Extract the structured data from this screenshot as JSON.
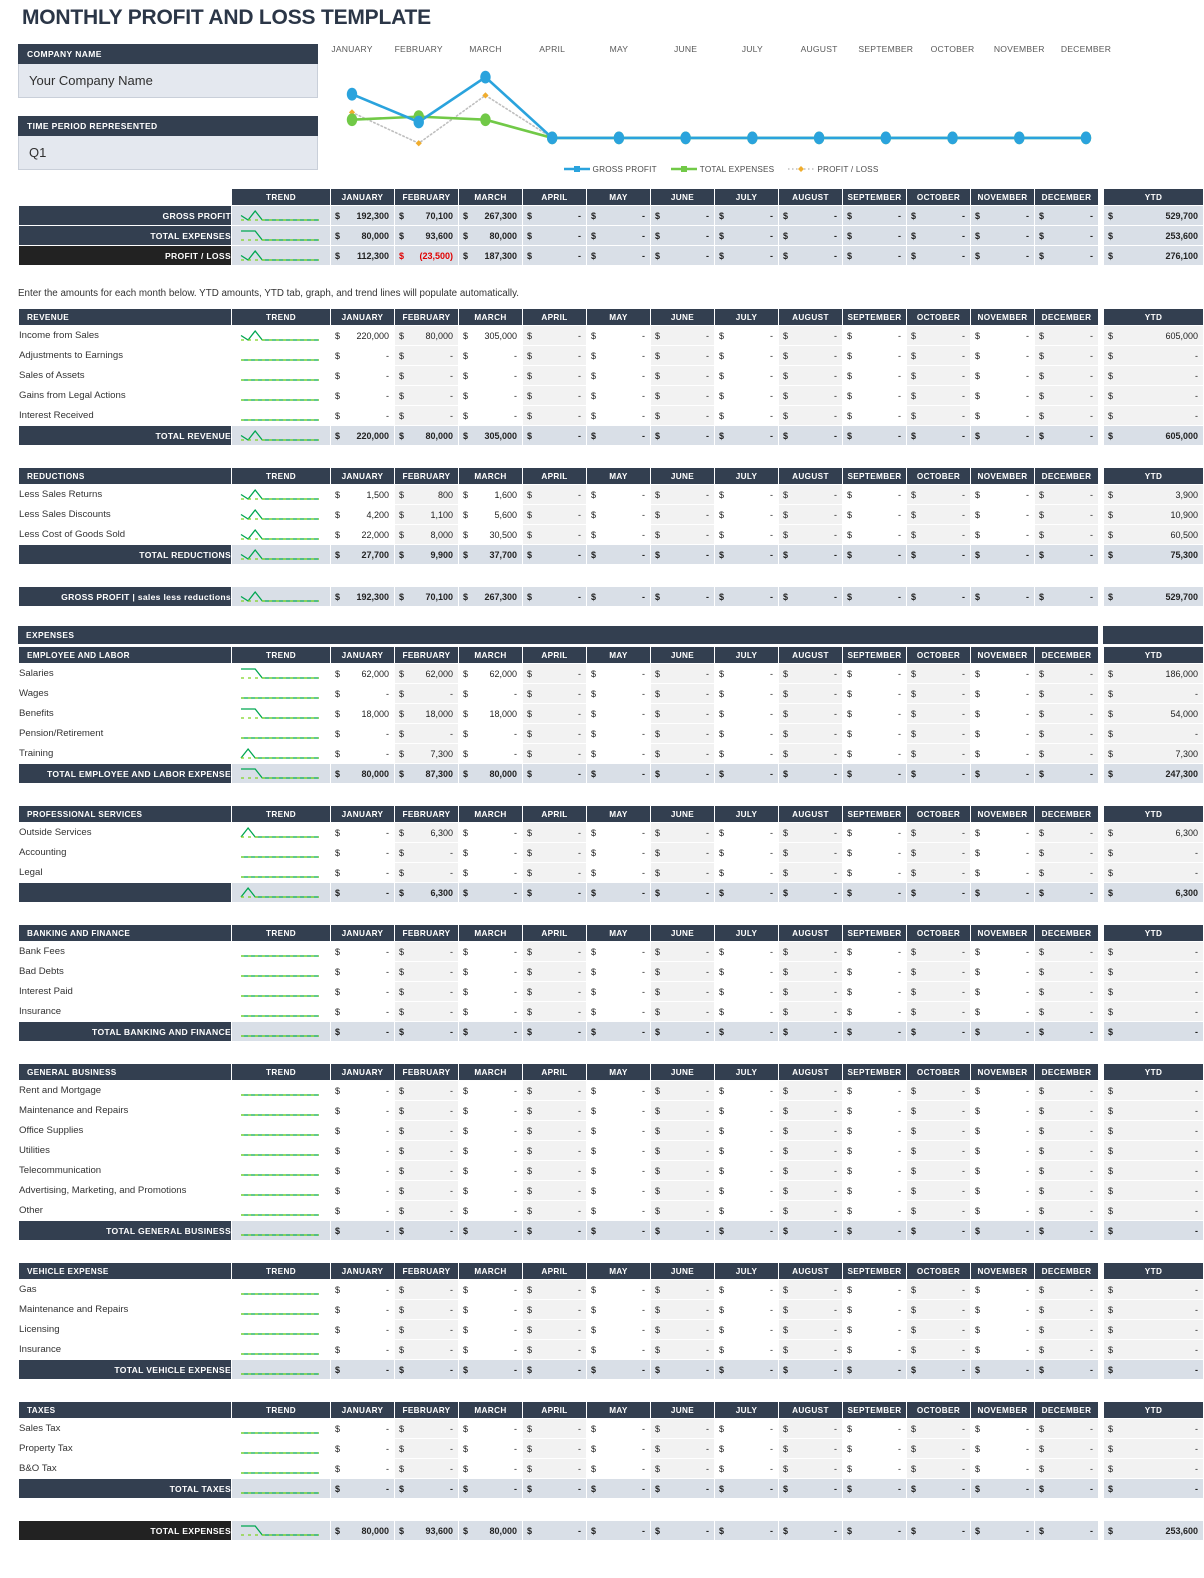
{
  "page_title": "MONTHLY PROFIT AND LOSS TEMPLATE",
  "info": {
    "company_label": "COMPANY NAME",
    "company_value": "Your Company Name",
    "period_label": "TIME PERIOD REPRESENTED",
    "period_value": "Q1"
  },
  "note": "Enter the amounts for each month below. YTD amounts, YTD tab, graph, and trend lines will populate automatically.",
  "months": [
    "JANUARY",
    "FEBRUARY",
    "MARCH",
    "APRIL",
    "MAY",
    "JUNE",
    "JULY",
    "AUGUST",
    "SEPTEMBER",
    "OCTOBER",
    "NOVEMBER",
    "DECEMBER"
  ],
  "col_trend": "TREND",
  "col_ytd": "YTD",
  "currency": "$",
  "dash": "-",
  "colors": {
    "header_dark": "#333f50",
    "header_black": "#222222",
    "total_fill": "#d9dfe7",
    "alt_fill": "#f2f2f2",
    "negative": "#e00000",
    "gross_profit_line": "#2aa3dd",
    "total_expenses_line": "#71c947",
    "profit_loss_line": "#bfbfbf",
    "profit_loss_marker": "#f0ad2e",
    "spark_line": "#00a651"
  },
  "chart_data": {
    "type": "line",
    "title": "",
    "xlabel": "",
    "ylabel": "",
    "categories": [
      "JANUARY",
      "FEBRUARY",
      "MARCH",
      "APRIL",
      "MAY",
      "JUNE",
      "JULY",
      "AUGUST",
      "SEPTEMBER",
      "OCTOBER",
      "NOVEMBER",
      "DECEMBER"
    ],
    "legend": [
      "GROSS PROFIT",
      "TOTAL EXPENSES",
      "PROFIT / LOSS"
    ],
    "legend_position": "bottom-center",
    "grid": false,
    "series": [
      {
        "name": "GROSS PROFIT",
        "color": "#2aa3dd",
        "values": [
          192300,
          70100,
          267300,
          0,
          0,
          0,
          0,
          0,
          0,
          0,
          0,
          0
        ]
      },
      {
        "name": "TOTAL EXPENSES",
        "color": "#71c947",
        "values": [
          80000,
          93600,
          80000,
          0,
          0,
          0,
          0,
          0,
          0,
          0,
          0,
          0
        ]
      },
      {
        "name": "PROFIT / LOSS",
        "color": "#bfbfbf",
        "values": [
          112300,
          -23500,
          187300,
          0,
          0,
          0,
          0,
          0,
          0,
          0,
          0,
          0
        ]
      }
    ],
    "ylim": [
      -40000,
      290000
    ]
  },
  "summary": {
    "header": [
      "",
      "TREND",
      "JANUARY",
      "FEBRUARY",
      "MARCH",
      "APRIL",
      "MAY",
      "JUNE",
      "JULY",
      "AUGUST",
      "SEPTEMBER",
      "OCTOBER",
      "NOVEMBER",
      "DECEMBER"
    ],
    "rows": [
      {
        "label": "GROSS PROFIT",
        "spark": "vpeak",
        "values": [
          "192,300",
          "70,100",
          "267,300",
          "-",
          "-",
          "-",
          "-",
          "-",
          "-",
          "-",
          "-",
          "-"
        ],
        "ytd": "529,700",
        "negatives": []
      },
      {
        "label": "TOTAL EXPENSES",
        "spark": "drop",
        "values": [
          "80,000",
          "93,600",
          "80,000",
          "-",
          "-",
          "-",
          "-",
          "-",
          "-",
          "-",
          "-",
          "-"
        ],
        "ytd": "253,600",
        "negatives": []
      },
      {
        "label": "PROFIT / LOSS",
        "spark": "vpeak",
        "values": [
          "112,300",
          "(23,500)",
          "187,300",
          "-",
          "-",
          "-",
          "-",
          "-",
          "-",
          "-",
          "-",
          "-"
        ],
        "ytd": "276,100",
        "negatives": [
          1
        ],
        "black": true
      }
    ]
  },
  "sections": [
    {
      "id": "revenue",
      "title": "REVENUE",
      "rows": [
        {
          "label": "Income from Sales",
          "spark": "vpeak",
          "values": [
            "220,000",
            "80,000",
            "305,000",
            "-",
            "-",
            "-",
            "-",
            "-",
            "-",
            "-",
            "-",
            "-"
          ],
          "ytd": "605,000"
        },
        {
          "label": "Adjustments to Earnings",
          "spark": "flat",
          "values": [
            "-",
            "-",
            "-",
            "-",
            "-",
            "-",
            "-",
            "-",
            "-",
            "-",
            "-",
            "-"
          ],
          "ytd": "-"
        },
        {
          "label": "Sales of Assets",
          "spark": "flat",
          "values": [
            "-",
            "-",
            "-",
            "-",
            "-",
            "-",
            "-",
            "-",
            "-",
            "-",
            "-",
            "-"
          ],
          "ytd": "-"
        },
        {
          "label": "Gains from Legal Actions",
          "spark": "flat",
          "values": [
            "-",
            "-",
            "-",
            "-",
            "-",
            "-",
            "-",
            "-",
            "-",
            "-",
            "-",
            "-"
          ],
          "ytd": "-"
        },
        {
          "label": "Interest Received",
          "spark": "flat",
          "values": [
            "-",
            "-",
            "-",
            "-",
            "-",
            "-",
            "-",
            "-",
            "-",
            "-",
            "-",
            "-"
          ],
          "ytd": "-"
        }
      ],
      "total": {
        "label": "TOTAL REVENUE",
        "spark": "vpeak",
        "values": [
          "220,000",
          "80,000",
          "305,000",
          "-",
          "-",
          "-",
          "-",
          "-",
          "-",
          "-",
          "-",
          "-"
        ],
        "ytd": "605,000"
      }
    },
    {
      "id": "reductions",
      "title": "REDUCTIONS",
      "rows": [
        {
          "label": "Less Sales Returns",
          "spark": "vpeak",
          "values": [
            "1,500",
            "800",
            "1,600",
            "-",
            "-",
            "-",
            "-",
            "-",
            "-",
            "-",
            "-",
            "-"
          ],
          "ytd": "3,900"
        },
        {
          "label": "Less Sales Discounts",
          "spark": "vpeak",
          "values": [
            "4,200",
            "1,100",
            "5,600",
            "-",
            "-",
            "-",
            "-",
            "-",
            "-",
            "-",
            "-",
            "-"
          ],
          "ytd": "10,900"
        },
        {
          "label": "Less Cost of Goods Sold",
          "spark": "vpeak",
          "values": [
            "22,000",
            "8,000",
            "30,500",
            "-",
            "-",
            "-",
            "-",
            "-",
            "-",
            "-",
            "-",
            "-"
          ],
          "ytd": "60,500"
        }
      ],
      "total": {
        "label": "TOTAL REDUCTIONS",
        "spark": "vpeak",
        "values": [
          "27,700",
          "9,900",
          "37,700",
          "-",
          "-",
          "-",
          "-",
          "-",
          "-",
          "-",
          "-",
          "-"
        ],
        "ytd": "75,300"
      }
    },
    {
      "id": "employee-labor",
      "title": "EMPLOYEE AND LABOR",
      "rows": [
        {
          "label": "Salaries",
          "spark": "drop",
          "values": [
            "62,000",
            "62,000",
            "62,000",
            "-",
            "-",
            "-",
            "-",
            "-",
            "-",
            "-",
            "-",
            "-"
          ],
          "ytd": "186,000"
        },
        {
          "label": "Wages",
          "spark": "flat",
          "values": [
            "-",
            "-",
            "-",
            "-",
            "-",
            "-",
            "-",
            "-",
            "-",
            "-",
            "-",
            "-"
          ],
          "ytd": "-"
        },
        {
          "label": "Benefits",
          "spark": "drop",
          "values": [
            "18,000",
            "18,000",
            "18,000",
            "-",
            "-",
            "-",
            "-",
            "-",
            "-",
            "-",
            "-",
            "-"
          ],
          "ytd": "54,000"
        },
        {
          "label": "Pension/Retirement",
          "spark": "flat",
          "values": [
            "-",
            "-",
            "-",
            "-",
            "-",
            "-",
            "-",
            "-",
            "-",
            "-",
            "-",
            "-"
          ],
          "ytd": "-"
        },
        {
          "label": "Training",
          "spark": "bump",
          "values": [
            "-",
            "7,300",
            "-",
            "-",
            "-",
            "-",
            "-",
            "-",
            "-",
            "-",
            "-",
            "-"
          ],
          "ytd": "7,300"
        }
      ],
      "total": {
        "label": "TOTAL EMPLOYEE AND LABOR EXPENSE",
        "spark": "drop",
        "values": [
          "80,000",
          "87,300",
          "80,000",
          "-",
          "-",
          "-",
          "-",
          "-",
          "-",
          "-",
          "-",
          "-"
        ],
        "ytd": "247,300"
      }
    },
    {
      "id": "professional-services",
      "title": "PROFESSIONAL SERVICES",
      "rows": [
        {
          "label": "Outside Services",
          "spark": "bump",
          "values": [
            "-",
            "6,300",
            "-",
            "-",
            "-",
            "-",
            "-",
            "-",
            "-",
            "-",
            "-",
            "-"
          ],
          "ytd": "6,300"
        },
        {
          "label": "Accounting",
          "spark": "flat",
          "values": [
            "-",
            "-",
            "-",
            "-",
            "-",
            "-",
            "-",
            "-",
            "-",
            "-",
            "-",
            "-"
          ],
          "ytd": "-"
        },
        {
          "label": "Legal",
          "spark": "flat",
          "values": [
            "-",
            "-",
            "-",
            "-",
            "-",
            "-",
            "-",
            "-",
            "-",
            "-",
            "-",
            "-"
          ],
          "ytd": "-"
        }
      ],
      "total": {
        "label": "",
        "spark": "bump",
        "values": [
          "-",
          "6,300",
          "-",
          "-",
          "-",
          "-",
          "-",
          "-",
          "-",
          "-",
          "-",
          "-"
        ],
        "ytd": "6,300"
      }
    },
    {
      "id": "banking-finance",
      "title": "BANKING AND FINANCE",
      "rows": [
        {
          "label": "Bank Fees",
          "spark": "flat",
          "values": [
            "-",
            "-",
            "-",
            "-",
            "-",
            "-",
            "-",
            "-",
            "-",
            "-",
            "-",
            "-"
          ],
          "ytd": "-"
        },
        {
          "label": "Bad Debts",
          "spark": "flat",
          "values": [
            "-",
            "-",
            "-",
            "-",
            "-",
            "-",
            "-",
            "-",
            "-",
            "-",
            "-",
            "-"
          ],
          "ytd": "-"
        },
        {
          "label": "Interest Paid",
          "spark": "flat",
          "values": [
            "-",
            "-",
            "-",
            "-",
            "-",
            "-",
            "-",
            "-",
            "-",
            "-",
            "-",
            "-"
          ],
          "ytd": "-"
        },
        {
          "label": "Insurance",
          "spark": "flat",
          "values": [
            "-",
            "-",
            "-",
            "-",
            "-",
            "-",
            "-",
            "-",
            "-",
            "-",
            "-",
            "-"
          ],
          "ytd": "-"
        }
      ],
      "total": {
        "label": "TOTAL BANKING AND FINANCE",
        "spark": "flat",
        "values": [
          "-",
          "-",
          "-",
          "-",
          "-",
          "-",
          "-",
          "-",
          "-",
          "-",
          "-",
          "-"
        ],
        "ytd": "-"
      }
    },
    {
      "id": "general-business",
      "title": "GENERAL BUSINESS",
      "rows": [
        {
          "label": "Rent and Mortgage",
          "spark": "flat",
          "values": [
            "-",
            "-",
            "-",
            "-",
            "-",
            "-",
            "-",
            "-",
            "-",
            "-",
            "-",
            "-"
          ],
          "ytd": "-"
        },
        {
          "label": "Maintenance and Repairs",
          "spark": "flat",
          "values": [
            "-",
            "-",
            "-",
            "-",
            "-",
            "-",
            "-",
            "-",
            "-",
            "-",
            "-",
            "-"
          ],
          "ytd": "-"
        },
        {
          "label": "Office Supplies",
          "spark": "flat",
          "values": [
            "-",
            "-",
            "-",
            "-",
            "-",
            "-",
            "-",
            "-",
            "-",
            "-",
            "-",
            "-"
          ],
          "ytd": "-"
        },
        {
          "label": "Utilities",
          "spark": "flat",
          "values": [
            "-",
            "-",
            "-",
            "-",
            "-",
            "-",
            "-",
            "-",
            "-",
            "-",
            "-",
            "-"
          ],
          "ytd": "-"
        },
        {
          "label": "Telecommunication",
          "spark": "flat",
          "values": [
            "-",
            "-",
            "-",
            "-",
            "-",
            "-",
            "-",
            "-",
            "-",
            "-",
            "-",
            "-"
          ],
          "ytd": "-"
        },
        {
          "label": "Advertising, Marketing, and Promotions",
          "spark": "flat",
          "values": [
            "-",
            "-",
            "-",
            "-",
            "-",
            "-",
            "-",
            "-",
            "-",
            "-",
            "-",
            "-"
          ],
          "ytd": "-"
        },
        {
          "label": "Other",
          "spark": "flat",
          "values": [
            "-",
            "-",
            "-",
            "-",
            "-",
            "-",
            "-",
            "-",
            "-",
            "-",
            "-",
            "-"
          ],
          "ytd": "-"
        }
      ],
      "total": {
        "label": "TOTAL GENERAL BUSINESS",
        "spark": "flat",
        "values": [
          "-",
          "-",
          "-",
          "-",
          "-",
          "-",
          "-",
          "-",
          "-",
          "-",
          "-",
          "-"
        ],
        "ytd": "-"
      }
    },
    {
      "id": "vehicle-expense",
      "title": "VEHICLE EXPENSE",
      "rows": [
        {
          "label": "Gas",
          "spark": "flat",
          "values": [
            "-",
            "-",
            "-",
            "-",
            "-",
            "-",
            "-",
            "-",
            "-",
            "-",
            "-",
            "-"
          ],
          "ytd": "-"
        },
        {
          "label": "Maintenance and Repairs",
          "spark": "flat",
          "values": [
            "-",
            "-",
            "-",
            "-",
            "-",
            "-",
            "-",
            "-",
            "-",
            "-",
            "-",
            "-"
          ],
          "ytd": "-"
        },
        {
          "label": "Licensing",
          "spark": "flat",
          "values": [
            "-",
            "-",
            "-",
            "-",
            "-",
            "-",
            "-",
            "-",
            "-",
            "-",
            "-",
            "-"
          ],
          "ytd": "-"
        },
        {
          "label": "Insurance",
          "spark": "flat",
          "values": [
            "-",
            "-",
            "-",
            "-",
            "-",
            "-",
            "-",
            "-",
            "-",
            "-",
            "-",
            "-"
          ],
          "ytd": "-"
        }
      ],
      "total": {
        "label": "TOTAL VEHICLE EXPENSE",
        "spark": "flat",
        "values": [
          "-",
          "-",
          "-",
          "-",
          "-",
          "-",
          "-",
          "-",
          "-",
          "-",
          "-",
          "-"
        ],
        "ytd": "-"
      }
    },
    {
      "id": "taxes",
      "title": "TAXES",
      "rows": [
        {
          "label": "Sales Tax",
          "spark": "flat",
          "values": [
            "-",
            "-",
            "-",
            "-",
            "-",
            "-",
            "-",
            "-",
            "-",
            "-",
            "-",
            "-"
          ],
          "ytd": "-"
        },
        {
          "label": "Property Tax",
          "spark": "flat",
          "values": [
            "-",
            "-",
            "-",
            "-",
            "-",
            "-",
            "-",
            "-",
            "-",
            "-",
            "-",
            "-"
          ],
          "ytd": "-"
        },
        {
          "label": "B&O Tax",
          "spark": "flat",
          "values": [
            "-",
            "-",
            "-",
            "-",
            "-",
            "-",
            "-",
            "-",
            "-",
            "-",
            "-",
            "-"
          ],
          "ytd": "-"
        }
      ],
      "total": {
        "label": "TOTAL TAXES",
        "spark": "flat",
        "values": [
          "-",
          "-",
          "-",
          "-",
          "-",
          "-",
          "-",
          "-",
          "-",
          "-",
          "-",
          "-"
        ],
        "ytd": "-"
      }
    }
  ],
  "expenses_bar": "EXPENSES",
  "gross_profit_row": {
    "label": "GROSS PROFIT  |  sales less reductions",
    "spark": "vpeak",
    "values": [
      "192,300",
      "70,100",
      "267,300",
      "-",
      "-",
      "-",
      "-",
      "-",
      "-",
      "-",
      "-",
      "-"
    ],
    "ytd": "529,700"
  },
  "total_expenses_row": {
    "label": "TOTAL EXPENSES",
    "spark": "drop",
    "values": [
      "80,000",
      "93,600",
      "80,000",
      "-",
      "-",
      "-",
      "-",
      "-",
      "-",
      "-",
      "-",
      "-"
    ],
    "ytd": "253,600"
  }
}
